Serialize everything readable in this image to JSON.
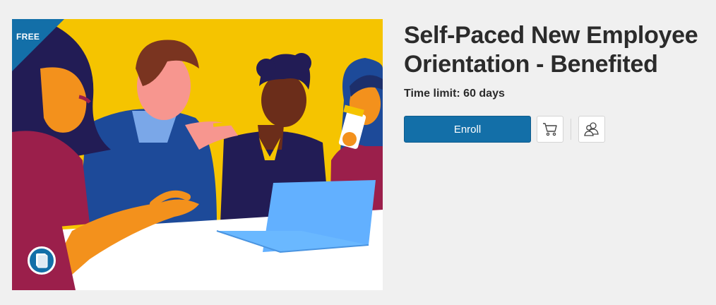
{
  "course": {
    "title": "Self-Paced New Employee Orientation - Benefited",
    "time_limit": "Time limit: 60 days",
    "price_badge": "FREE"
  },
  "actions": {
    "enroll_label": "Enroll",
    "cart_icon": "shopping-cart-icon",
    "group_icon": "users-icon"
  },
  "image": {
    "course_type_icon": "book-icon"
  },
  "colors": {
    "accent": "#136fa8",
    "title_text": "#2b2b2b",
    "background": "#f0f0f0",
    "illustration_yellow": "#f5c400"
  }
}
